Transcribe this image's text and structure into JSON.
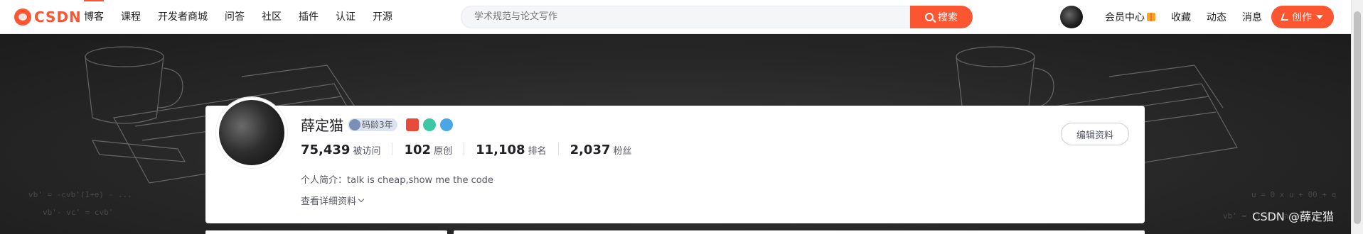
{
  "topbar": {
    "logo": "CSDN",
    "nav": [
      "博客",
      "课程",
      "开发者商城",
      "问答",
      "社区",
      "插件",
      "认证",
      "开源"
    ],
    "active_nav": "博客",
    "search_placeholder": "学术规范与论文写作",
    "search_button": "搜索",
    "right_nav": [
      "会员中心",
      "收藏",
      "动态",
      "消息"
    ],
    "create_button": "创作"
  },
  "profile": {
    "name": "薛定猫",
    "years_badge": "码龄3年",
    "stats": [
      {
        "value": "75,439",
        "label": "被访问"
      },
      {
        "value": "102",
        "label": "原创"
      },
      {
        "value": "11,108",
        "label": "排名"
      },
      {
        "value": "2,037",
        "label": "粉丝"
      }
    ],
    "bio": "个人简介：talk is cheap,show me the code",
    "more": "查看详细资料",
    "edit_button": "编辑资料"
  },
  "banner": {
    "watermark": "CSDN @薛定猫"
  },
  "colors": {
    "brand": "#fc5531",
    "text": "#222226",
    "muted": "#555666"
  }
}
